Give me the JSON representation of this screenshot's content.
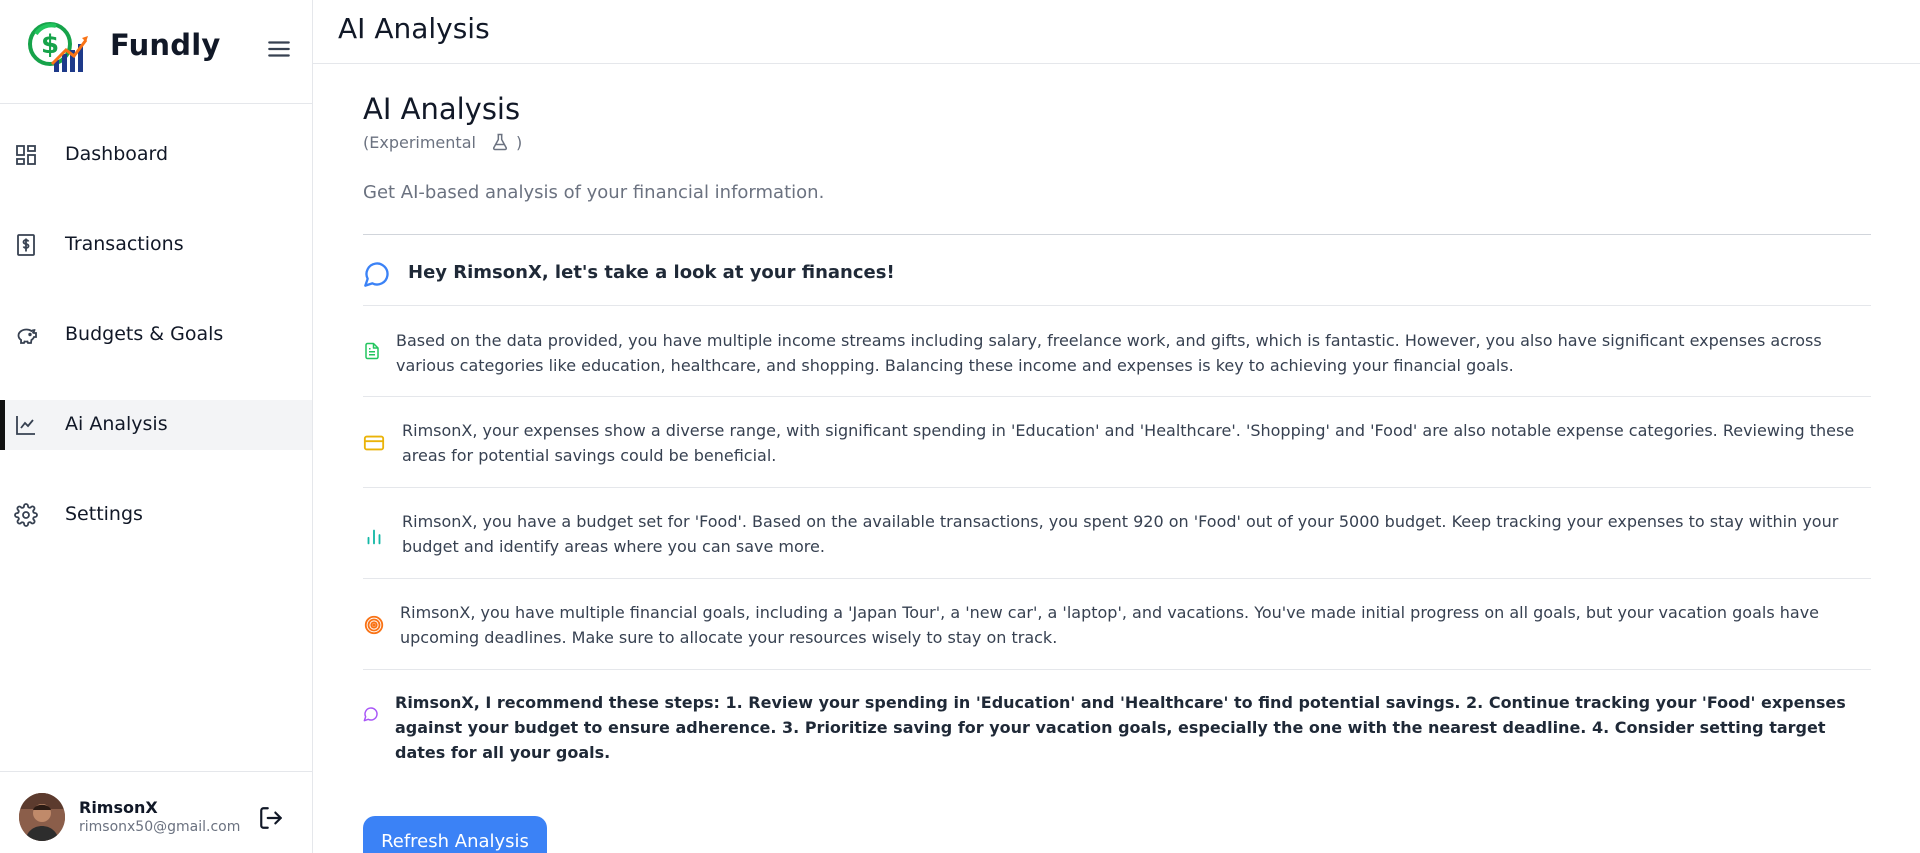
{
  "app": {
    "name": "Fundly"
  },
  "sidebar": {
    "items": [
      {
        "label": "Dashboard",
        "icon": "dashboard-icon"
      },
      {
        "label": "Transactions",
        "icon": "receipt-dollar-icon"
      },
      {
        "label": "Budgets & Goals",
        "icon": "piggy-bank-icon"
      },
      {
        "label": "Ai Analysis",
        "icon": "line-chart-icon",
        "active": true
      },
      {
        "label": "Settings",
        "icon": "gear-icon"
      }
    ],
    "user": {
      "name": "RimsonX",
      "email": "rimsonx50@gmail.com"
    }
  },
  "topbar": {
    "title": "AI Analysis"
  },
  "main": {
    "title": "AI Analysis",
    "subtitle_open": "(Experimental",
    "subtitle_close": ")",
    "description": "Get AI-based analysis of your financial information.",
    "greeting": "Hey RimsonX, let's take a look at your finances!",
    "insights": [
      {
        "icon": "document-icon",
        "color": "#22c55e",
        "text": "Based on the data provided, you have multiple income streams including salary, freelance work, and gifts, which is fantastic. However, you also have significant expenses across various categories like education, healthcare, and shopping. Balancing these income and expenses is key to achieving your financial goals."
      },
      {
        "icon": "credit-card-icon",
        "color": "#eab308",
        "text": "RimsonX, your expenses show a diverse range, with significant spending in 'Education' and 'Healthcare'. 'Shopping' and 'Food' are also notable expense categories. Reviewing these areas for potential savings could be beneficial."
      },
      {
        "icon": "bar-chart-icon",
        "color": "#14b8a6",
        "text": "RimsonX, you have a budget set for 'Food'. Based on the available transactions, you spent 920 on 'Food' out of your 5000 budget. Keep tracking your expenses to stay within your budget and identify areas where you can save more."
      },
      {
        "icon": "target-icon",
        "color": "#f97316",
        "text": "RimsonX, you have multiple financial goals, including a 'Japan Tour', a 'new car', a 'laptop', and vacations. You've made initial progress on all goals, but your vacation goals have upcoming deadlines. Make sure to allocate your resources wisely to stay on track."
      },
      {
        "icon": "chat-bubble-icon",
        "color": "#a855f7",
        "text": "RimsonX, I recommend these steps: 1. Review your spending in 'Education' and 'Healthcare' to find potential savings. 2. Continue tracking your 'Food' expenses against your budget to ensure adherence. 3. Prioritize saving for your vacation goals, especially the one with the nearest deadline. 4. Consider setting target dates for all your goals."
      }
    ],
    "refresh_label": "Refresh Analysis"
  },
  "colors": {
    "accent": "#3b82f6",
    "greeting_icon": "#3b82f6"
  }
}
